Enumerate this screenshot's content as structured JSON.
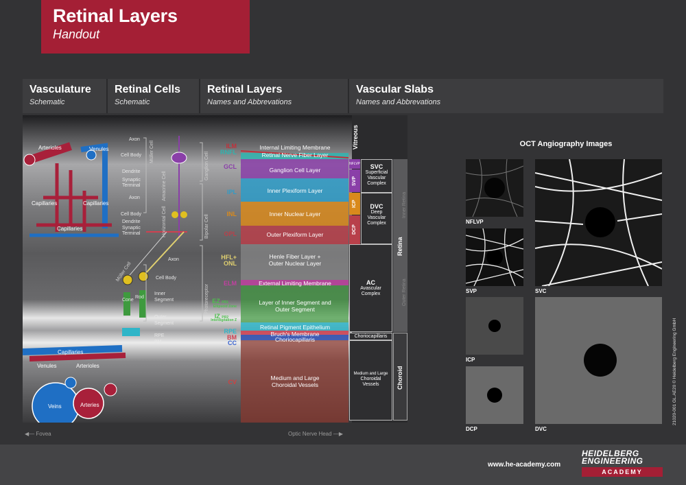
{
  "header": {
    "title": "Retinal Layers",
    "subtitle": "Handout"
  },
  "columns": [
    {
      "title": "Vasculature",
      "subtitle": "Schematic"
    },
    {
      "title": "Retinal Cells",
      "subtitle": "Schematic"
    },
    {
      "title": "Retinal Layers",
      "subtitle": "Names and Abbrevations"
    },
    {
      "title": "Vascular Slabs",
      "subtitle": "Names and Abbrevations"
    }
  ],
  "vasculature": {
    "arterioles": "Arterioles",
    "venules": "Venules",
    "capillaries_a": "Capillaries",
    "capillaries_b": "Capillaries",
    "capillaries_c": "Capillaries",
    "capillaries_d": "Capillaries",
    "venules_b": "Venules",
    "arterioles_b": "Arterioles",
    "veins": "Veins",
    "arteries": "Arteries"
  },
  "cells": {
    "axon1": "Axon",
    "cell_body1": "Cell Body",
    "dendrite1": "Dendrite",
    "synaptic1": "Synaptic",
    "terminal1": "Terminal",
    "axon2": "Axon",
    "cell_body2": "Cell Body",
    "dendrite2": "Dendrite",
    "synaptic2": "Synaptic",
    "terminal2": "Terminal",
    "axon3": "Axon",
    "cell_body3": "Cell Body",
    "cone": "Cone",
    "rod": "Rod",
    "inner": "Inner",
    "segment1": "Segment",
    "outer": "Outer",
    "segment2": "Segment",
    "rpe": "RPE",
    "bm": "BM",
    "muller_cell": "Müller Cell",
    "amacrine_cell": "Amacrine Cell",
    "horizontal_cell": "Horizontal Cell",
    "muller_cell2": "Müller Cell",
    "ganglion_cell": "Ganglion Cell",
    "bipolar_cell": "Bipolar Cell",
    "photoreceptor": "Photoreceptor"
  },
  "layers": [
    {
      "abbr": "ILM",
      "name": "Internal Limiting Membrane",
      "color": "#c0303a"
    },
    {
      "abbr": "RNFL",
      "name": "Retinal Nerve Fiber Layer",
      "color": "#2fb5b0"
    },
    {
      "abbr": "GCL",
      "name": "Ganglion Cell Layer",
      "color": "#8a3fa8"
    },
    {
      "abbr": "IPL",
      "name": "Inner Plexiform Layer",
      "color": "#2e9cc8"
    },
    {
      "abbr": "INL",
      "name": "Inner Nuclear Layer",
      "color": "#d98a1c"
    },
    {
      "abbr": "OPL",
      "name": "Outer Plexiform Layer",
      "color": "#b8404a"
    },
    {
      "abbr": "HFL+",
      "abbr2": "ONL",
      "name": "Henle Fiber Layer +",
      "name2": "Outer Nuclear Layer",
      "color": "#e0d070"
    },
    {
      "abbr": "ELM",
      "name": "External Limiting Membrane",
      "color": "#c040a0"
    },
    {
      "abbr": "EZ",
      "abbr_small": "PR1",
      "abbr_sub": "Ellipsoid Zone",
      "name": "Layer of Inner Segment and",
      "name2": "Outer Segment",
      "color": "#3e9a3e"
    },
    {
      "abbr": "IZ",
      "abbr_small": "PR2",
      "abbr_sub": "Interdigitation Z",
      "color": "#3e9a3e"
    },
    {
      "abbr": "RPE",
      "name": "Retinal Pigment Epithelium",
      "color": "#2fb5c8"
    },
    {
      "abbr": "BM",
      "name": "Bruch's Membrane",
      "color": "#d04050"
    },
    {
      "abbr": "CC",
      "name": "Choriocapillaris",
      "color": "#3050b0"
    },
    {
      "abbr": "CV",
      "name": "Medium and Large",
      "name2": "Choroidal Vessels",
      "color": "#b03030"
    }
  ],
  "slabs": {
    "vitreous": "Vitreous",
    "nflvp": "NFLVP",
    "svp": "SVP",
    "icp": "ICP",
    "dcp": "DCP",
    "svc": {
      "title": "SVC",
      "line1": "Superficial",
      "line2": "Vascular",
      "line3": "Complex"
    },
    "dvc": {
      "title": "DVC",
      "line1": "Deep",
      "line2": "Vascular",
      "line3": "Complex"
    },
    "ac": {
      "title": "AC",
      "line1": "Avascular",
      "line2": "Complex"
    },
    "choriocapillaris": "Choriocapillaris",
    "choroid_vessels": {
      "line1": "Medium and Large",
      "line2": "Choroidal",
      "line3": "Vessels"
    },
    "inner_retina": "Inner Retina",
    "outer_retina": "Outer Retina",
    "retina": "Retina",
    "choroid": "Choroid"
  },
  "axis": {
    "fovea": "Fovea",
    "optic_nerve_head": "Optic Nerve Head"
  },
  "oct": {
    "title": "OCT Angiography Images",
    "labels": {
      "nflvp": "NFLVP",
      "svp": "SVP",
      "icp": "ICP",
      "dcp": "DCP",
      "svc": "SVC",
      "dvc": "DVC"
    }
  },
  "credit": "21020-001 GL.AE20 © Heidelberg Engineering GmbH",
  "footer": {
    "url": "www.he-academy.com",
    "logo_line1": "HEIDELBERG",
    "logo_line2": "ENGINEERING",
    "logo_line3": "ACADEMY"
  },
  "colors": {
    "brand_red": "#a41f35",
    "artery": "#a8203a",
    "vein": "#1f6fc4"
  }
}
